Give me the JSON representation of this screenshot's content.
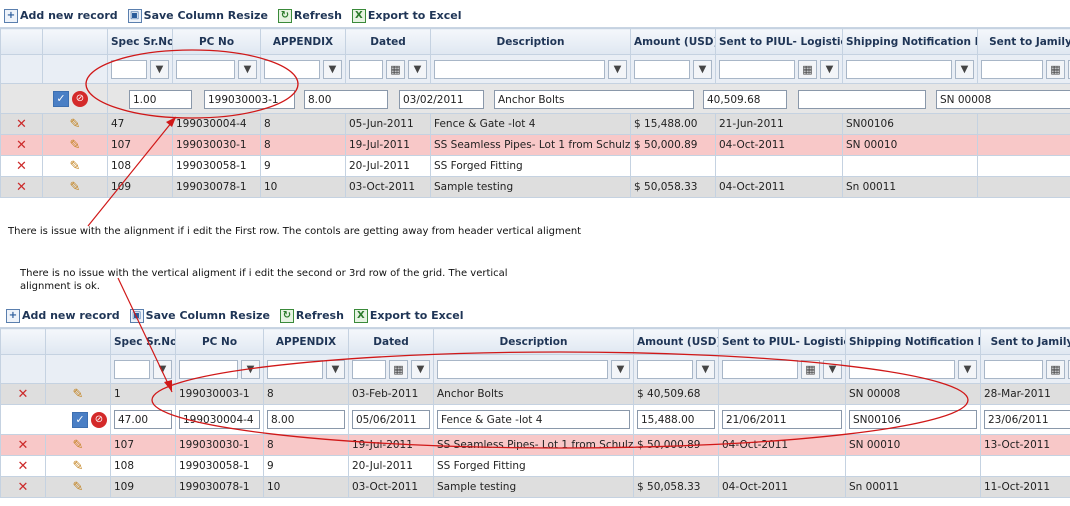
{
  "toolbar": {
    "add_label": "Add new record",
    "save_resize_label": "Save Column Resize",
    "refresh_label": "Refresh",
    "export_label": "Export to Excel"
  },
  "columns": [
    "Spec Sr.No.",
    "PC No",
    "APPENDIX",
    "Dated",
    "Description",
    "Amount (USD)",
    "Sent to PIUL- Logistics",
    "Shipping Notification NO",
    "Sent to Jamilya"
  ],
  "grid1": {
    "edit_row": {
      "spec": "1.00",
      "pc_no": "199030003-1",
      "appendix": "8.00",
      "dated": "03/02/2011",
      "description": "Anchor Bolts",
      "amount": "40,509.68",
      "sent_piul": "",
      "shipping": "SN 00008"
    },
    "rows": [
      {
        "spec": "47",
        "pc_no": "199030004-4",
        "appendix": "8",
        "dated": "05-Jun-2011",
        "description": "Fence & Gate -lot 4",
        "amount": "$ 15,488.00",
        "sent_piul": "21-Jun-2011",
        "shipping": "SN00106",
        "jamilya": ""
      },
      {
        "spec": "107",
        "pc_no": "199030030-1",
        "appendix": "8",
        "dated": "19-Jul-2011",
        "description": "SS Seamless Pipes- Lot 1 from Schulz",
        "amount": "$ 50,000.89",
        "sent_piul": "04-Oct-2011",
        "shipping": "SN 00010",
        "jamilya": ""
      },
      {
        "spec": "108",
        "pc_no": "199030058-1",
        "appendix": "9",
        "dated": "20-Jul-2011",
        "description": "SS Forged Fitting",
        "amount": "",
        "sent_piul": "",
        "shipping": "",
        "jamilya": ""
      },
      {
        "spec": "109",
        "pc_no": "199030078-1",
        "appendix": "10",
        "dated": "03-Oct-2011",
        "description": "Sample testing",
        "amount": "$ 50,058.33",
        "sent_piul": "04-Oct-2011",
        "shipping": "Sn 00011",
        "jamilya": ""
      }
    ]
  },
  "grid2": {
    "first_row": {
      "spec": "1",
      "pc_no": "199030003-1",
      "appendix": "8",
      "dated": "03-Feb-2011",
      "description": "Anchor Bolts",
      "amount": "$ 40,509.68",
      "sent_piul": "",
      "shipping": "SN 00008",
      "jamilya": "28-Mar-2011"
    },
    "edit_row": {
      "spec": "47.00",
      "pc_no": "199030004-4",
      "appendix": "8.00",
      "dated": "05/06/2011",
      "description": "Fence & Gate -lot 4",
      "amount": "15,488.00",
      "sent_piul": "21/06/2011",
      "shipping": "SN00106",
      "jamilya": "23/06/2011"
    },
    "rows": [
      {
        "spec": "107",
        "pc_no": "199030030-1",
        "appendix": "8",
        "dated": "19-Jul-2011",
        "description": "SS Seamless Pipes- Lot 1 from Schulz",
        "amount": "$ 50,000.89",
        "sent_piul": "04-Oct-2011",
        "shipping": "SN 00010",
        "jamilya": "13-Oct-2011"
      },
      {
        "spec": "108",
        "pc_no": "199030058-1",
        "appendix": "9",
        "dated": "20-Jul-2011",
        "description": "SS Forged Fitting",
        "amount": "",
        "sent_piul": "",
        "shipping": "",
        "jamilya": ""
      },
      {
        "spec": "109",
        "pc_no": "199030078-1",
        "appendix": "10",
        "dated": "03-Oct-2011",
        "description": "Sample testing",
        "amount": "$ 50,058.33",
        "sent_piul": "04-Oct-2011",
        "shipping": "Sn 00011",
        "jamilya": "11-Oct-2011"
      }
    ]
  },
  "notes": {
    "first": "There is issue with the alignment if i edit the First row. The contols are getting away from header vertical aligment",
    "second": "There is no issue with the vertical aligment if i edit the second or 3rd row of the grid. The vertical alignment is ok."
  },
  "colors": {
    "annotation": "#d01818",
    "pink_row": "#f8c8c8",
    "grey_row": "#dedede",
    "header": "#1f3556"
  }
}
